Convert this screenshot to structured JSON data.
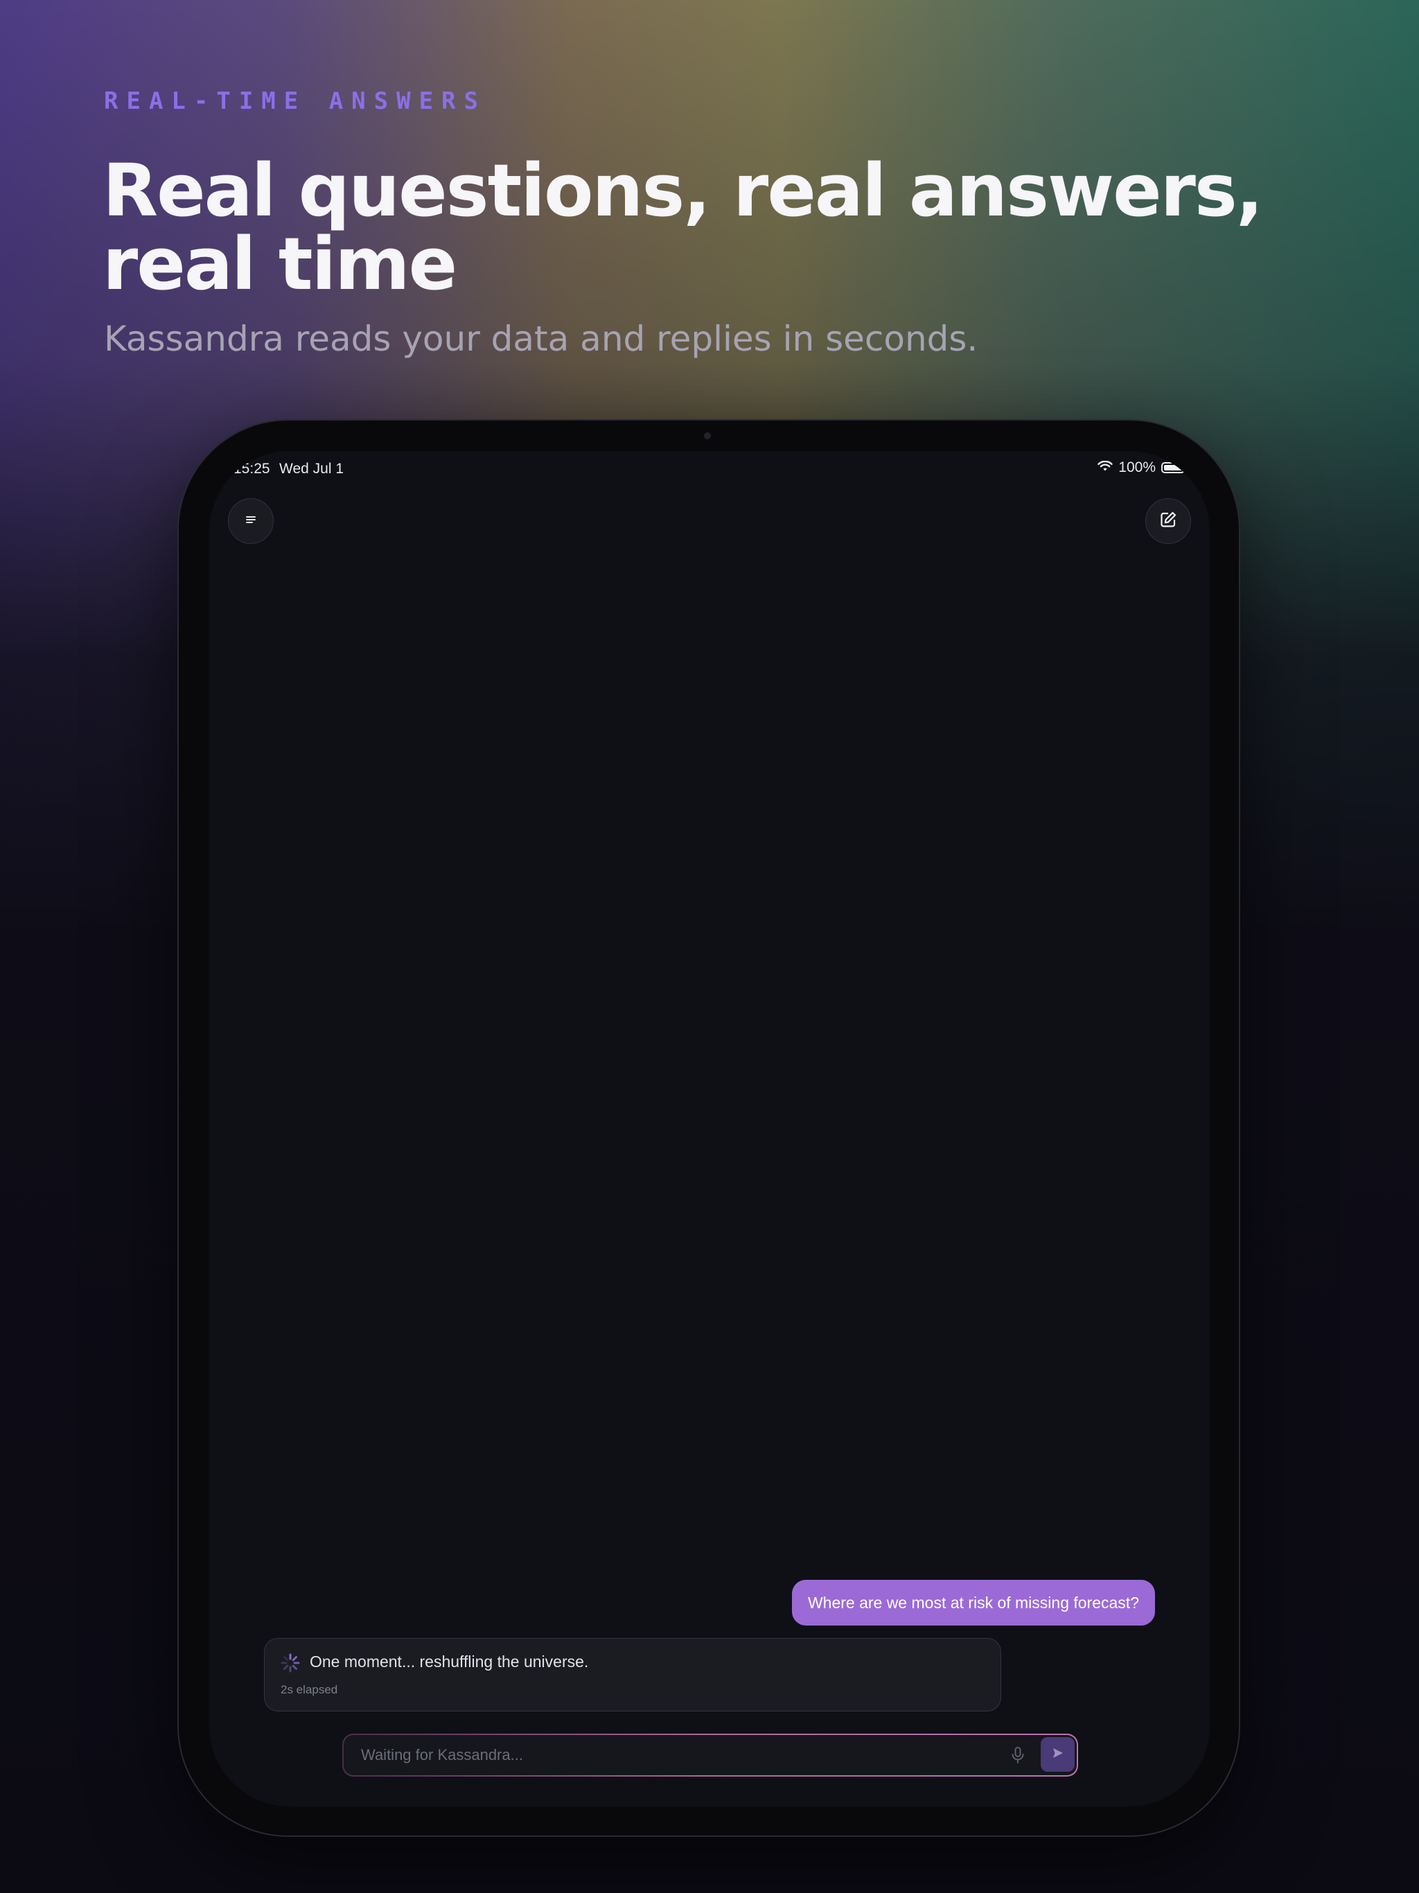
{
  "hero": {
    "eyebrow": "REAL-TIME ANSWERS",
    "headline": "Real questions, real answers, real time",
    "subhead": "Kassandra reads your data and replies in seconds."
  },
  "status_bar": {
    "time": "15:25",
    "date": "Wed Jul 1",
    "battery_percent": "100%",
    "battery_level": 1.0
  },
  "toolbar": {
    "menu_icon": "menu-icon",
    "compose_icon": "compose-icon"
  },
  "chat": {
    "user_message": "Where are we most at risk of missing forecast?",
    "assistant_status": "One moment... reshuffling the universe.",
    "elapsed": "2s elapsed"
  },
  "input": {
    "placeholder": "Waiting for Kassandra...",
    "mic_icon": "mic-icon",
    "send_icon": "send-icon"
  },
  "colors": {
    "accent": "#9b6ad6",
    "eyebrow": "#8b6fe8",
    "send_button": "#4a3a77",
    "screen_bg": "#0e1016"
  }
}
